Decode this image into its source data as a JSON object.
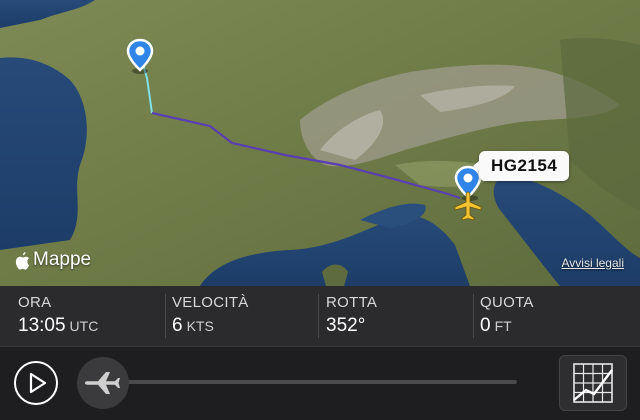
{
  "map": {
    "flight_label": "HG2154",
    "maps_brand": "Mappe",
    "legal_link": "Avvisi legali"
  },
  "stats": {
    "time": {
      "label": "ORA",
      "value": "13:05",
      "unit": "UTC"
    },
    "speed": {
      "label": "VELOCITÀ",
      "value": "6",
      "unit": "KTS"
    },
    "heading": {
      "label": "ROTTA",
      "value": "352°",
      "unit": ""
    },
    "altitude": {
      "label": "QUOTA",
      "value": "0",
      "unit": "FT"
    }
  },
  "player": {
    "play_icon": "play-icon",
    "plane_icon": "airplane-icon",
    "grid_icon": "grid-chart-icon"
  },
  "colors": {
    "route": "#5a3fb0",
    "route_start": "#7fe0e8",
    "pin": "#2f86e8",
    "aircraft": "#f2c230"
  }
}
